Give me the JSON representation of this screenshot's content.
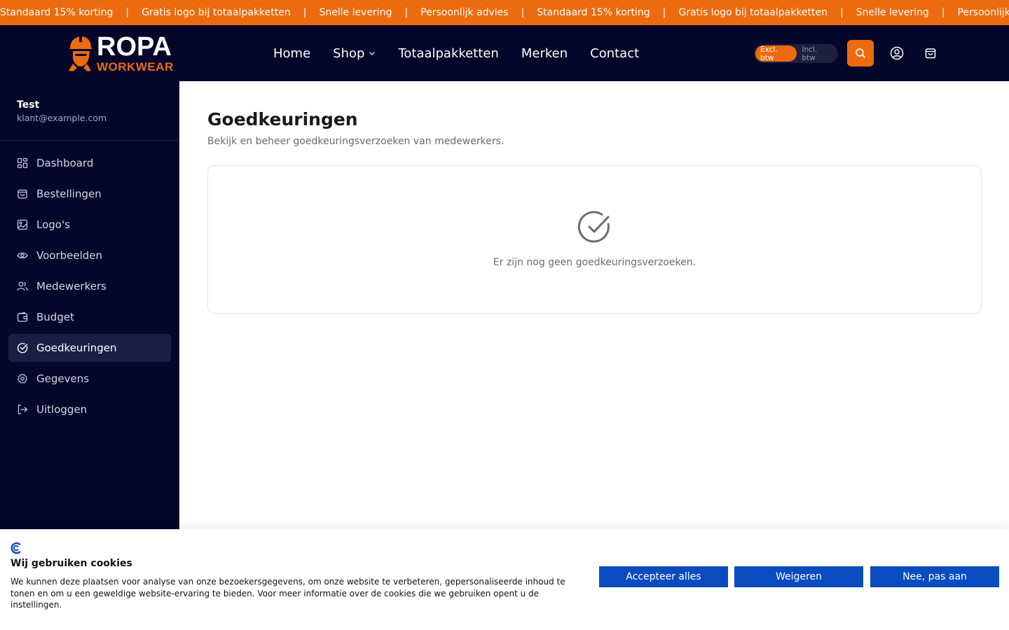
{
  "promo": {
    "items": [
      "Standaard 15% korting",
      "Gratis logo bij totaalpakketten",
      "Snelle levering",
      "Persoonlijk advies",
      "Standaard 15% korting",
      "Gratis logo bij totaalpakketten",
      "Snelle levering",
      "Persoonlijk advies"
    ],
    "separator": "|"
  },
  "header": {
    "logo_primary": "ROPA",
    "logo_secondary": "WORKWEAR",
    "nav": [
      "Home",
      "Shop",
      "Totaalpakketten",
      "Merken",
      "Contact"
    ],
    "btw_toggle": {
      "excl": "Excl. btw",
      "incl": "Incl. btw",
      "active": "excl"
    },
    "icons": [
      "search-icon",
      "user-icon",
      "shopping-bag-icon"
    ]
  },
  "sidebar": {
    "user_name": "Test",
    "user_email": "klant@example.com",
    "items": [
      {
        "label": "Dashboard",
        "icon": "dashboard-icon"
      },
      {
        "label": "Bestellingen",
        "icon": "shopping-bag-icon"
      },
      {
        "label": "Logo's",
        "icon": "image-icon"
      },
      {
        "label": "Voorbeelden",
        "icon": "eye-icon"
      },
      {
        "label": "Medewerkers",
        "icon": "users-icon"
      },
      {
        "label": "Budget",
        "icon": "wallet-icon"
      },
      {
        "label": "Goedkeuringen",
        "icon": "check-circle-icon",
        "active": true
      },
      {
        "label": "Gegevens",
        "icon": "gear-icon"
      },
      {
        "label": "Uitloggen",
        "icon": "logout-icon"
      }
    ]
  },
  "main": {
    "title": "Goedkeuringen",
    "subtitle": "Bekijk en beheer goedkeuringsverzoeken van medewerkers.",
    "empty_text": "Er zijn nog geen goedkeuringsverzoeken."
  },
  "cookie": {
    "title": "Wij gebruiken cookies",
    "text": "We kunnen deze plaatsen voor analyse van onze bezoekersgegevens, om onze website te verbeteren, gepersonaliseerde inhoud te tonen en om u een geweldige website-ervaring te bieden. Voor meer informatie over de cookies die we gebruiken opent u de instellingen.",
    "accept": "Accepteer alles",
    "reject": "Weigeren",
    "customize": "Nee, pas aan"
  },
  "colors": {
    "accent": "#ec6b0e",
    "navy": "#04062a",
    "cookie_button": "#0a4cc0"
  }
}
